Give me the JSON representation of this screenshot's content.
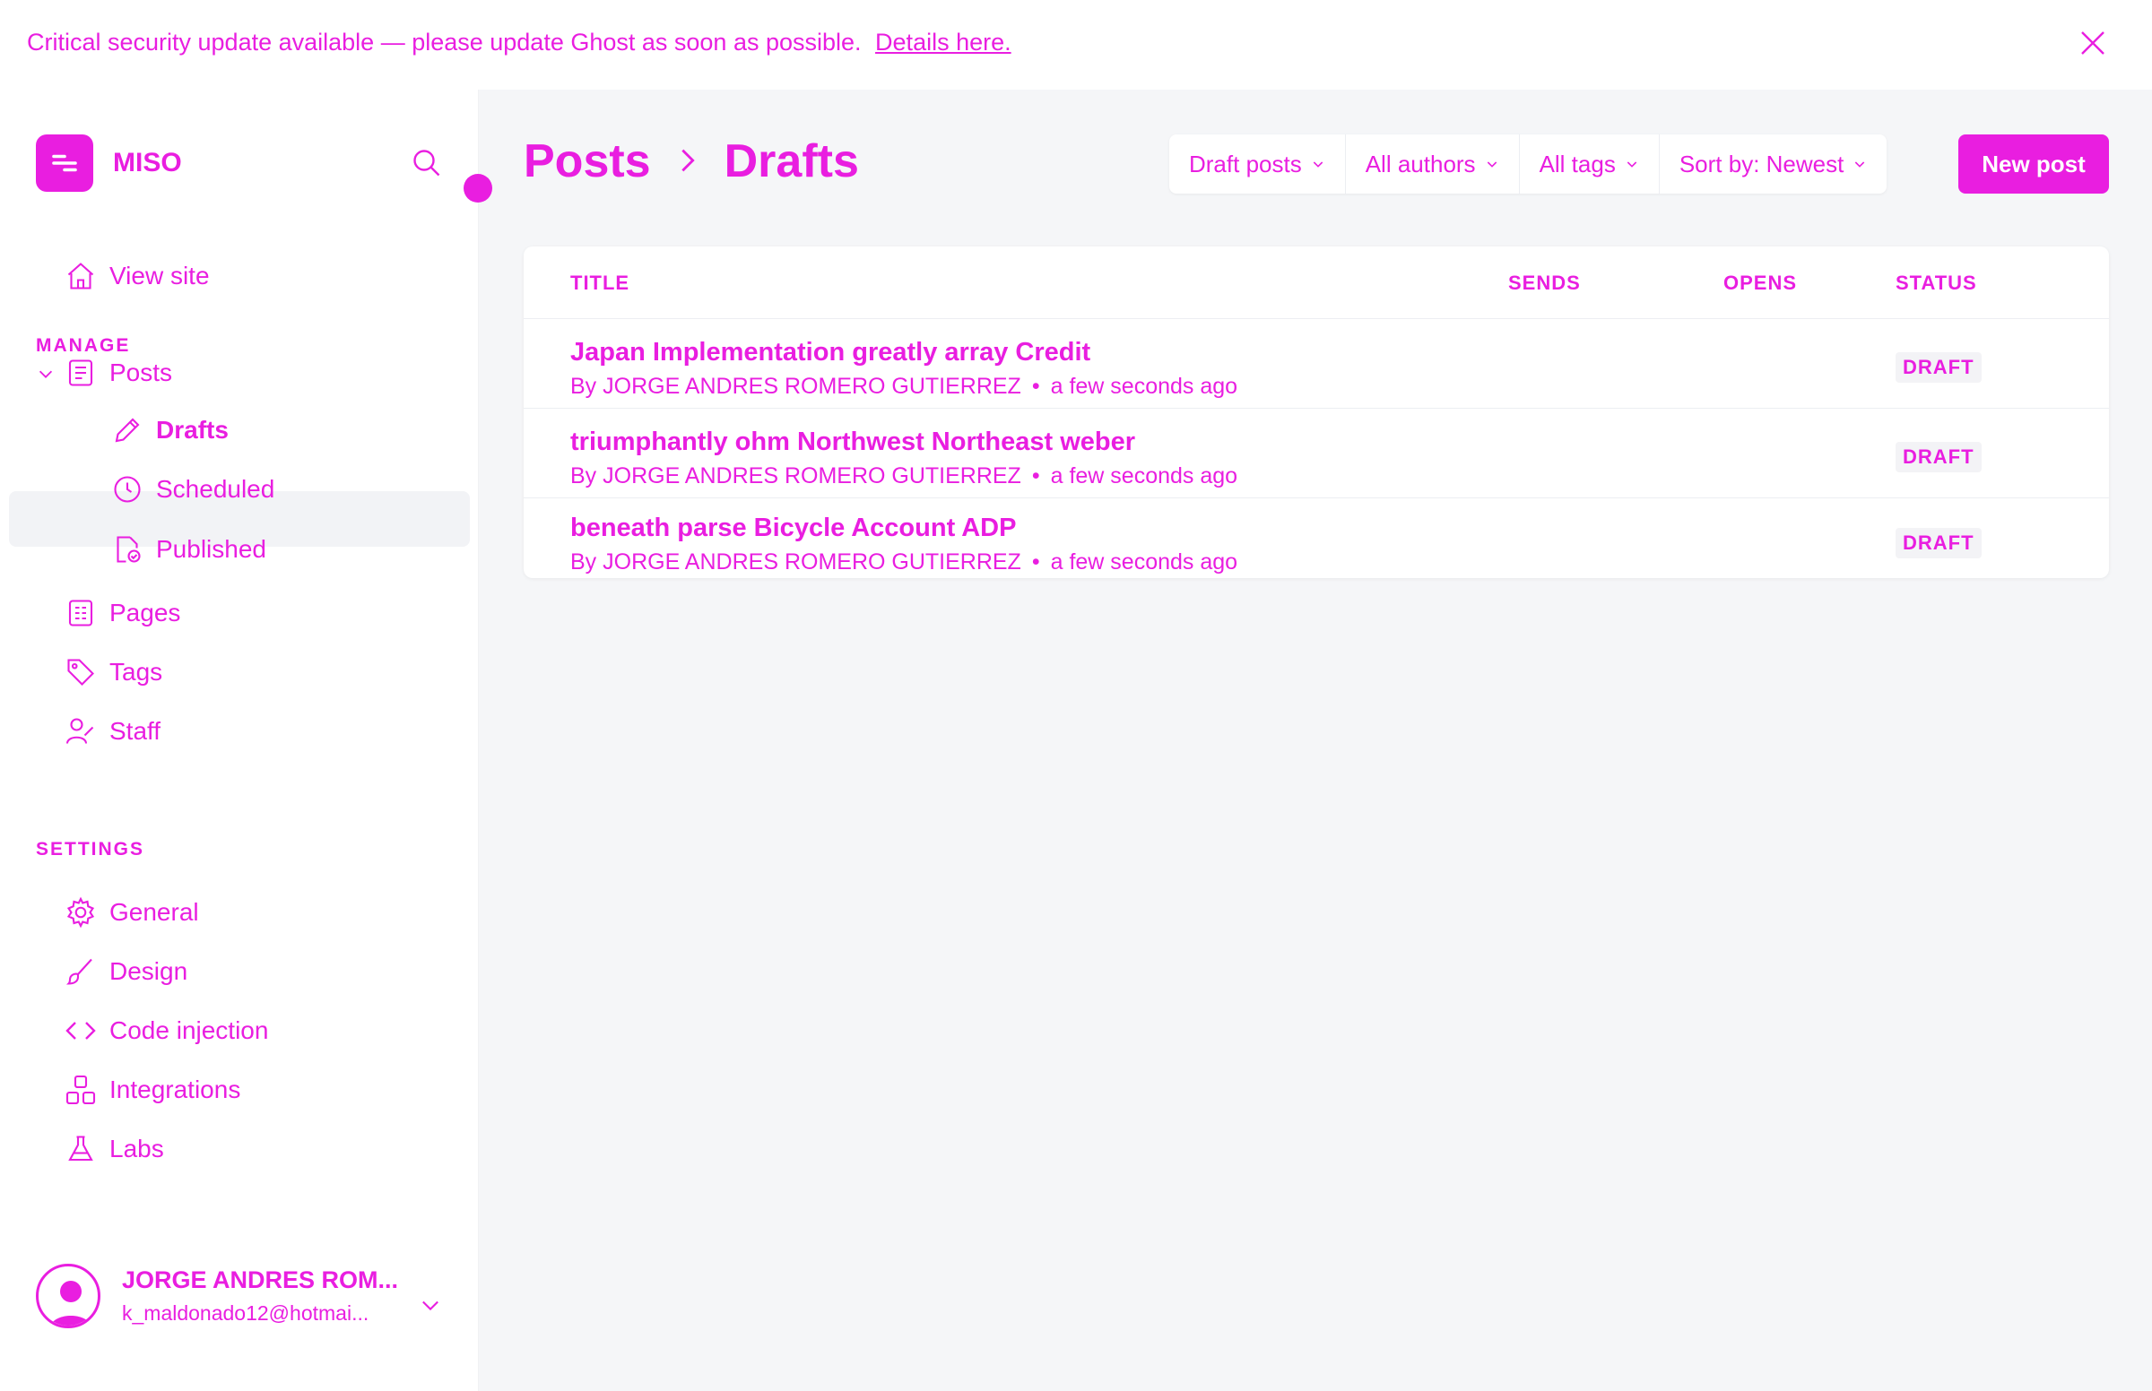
{
  "banner": {
    "text": "Critical security update available — please update Ghost as soon as possible.",
    "link": "Details here."
  },
  "sidebar": {
    "site_name": "MISO",
    "view_site": "View site",
    "manage_heading": "MANAGE",
    "settings_heading": "SETTINGS",
    "items": {
      "posts": "Posts",
      "drafts": "Drafts",
      "scheduled": "Scheduled",
      "published": "Published",
      "pages": "Pages",
      "tags": "Tags",
      "staff": "Staff",
      "general": "General",
      "design": "Design",
      "code_injection": "Code injection",
      "integrations": "Integrations",
      "labs": "Labs"
    },
    "user": {
      "name": "JORGE ANDRES ROM...",
      "email": "k_maldonado12@hotmai..."
    }
  },
  "header": {
    "crumb_root": "Posts",
    "crumb_current": "Drafts",
    "filters": [
      "Draft posts",
      "All authors",
      "All tags",
      "Sort by: Newest"
    ],
    "new_post": "New post"
  },
  "table": {
    "columns": {
      "title": "TITLE",
      "sends": "SENDS",
      "opens": "OPENS",
      "status": "STATUS"
    },
    "rows": [
      {
        "title": "Japan Implementation greatly array Credit",
        "author": "By JORGE ANDRES ROMERO GUTIERREZ",
        "time": "a few seconds ago",
        "status": "DRAFT"
      },
      {
        "title": "triumphantly ohm Northwest Northeast weber",
        "author": "By JORGE ANDRES ROMERO GUTIERREZ",
        "time": "a few seconds ago",
        "status": "DRAFT"
      },
      {
        "title": "beneath parse Bicycle Account ADP",
        "author": "By JORGE ANDRES ROMERO GUTIERREZ",
        "time": "a few seconds ago",
        "status": "DRAFT"
      }
    ]
  },
  "colors": {
    "accent": "#e91ee0",
    "main_bg": "#f5f6f8",
    "active_bg": "#f2f3f6"
  }
}
